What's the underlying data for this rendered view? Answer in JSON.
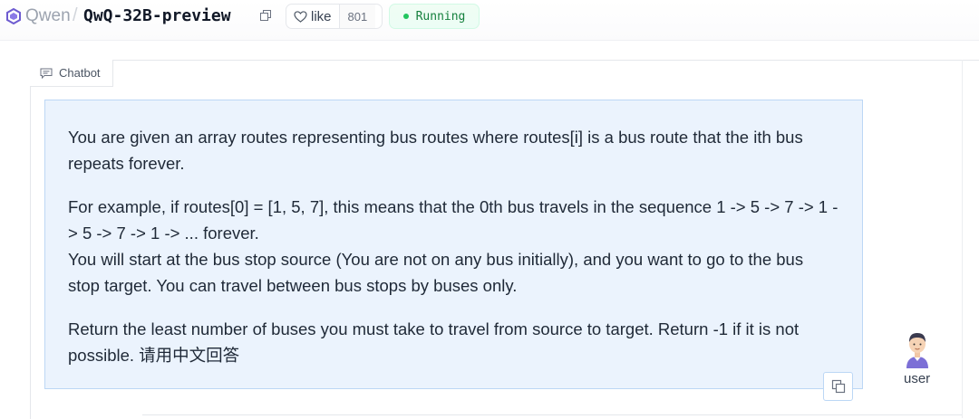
{
  "header": {
    "org_name": "Qwen",
    "separator": "/",
    "repo_name": "QwQ-32B-preview",
    "like_label": "like",
    "like_count": "801",
    "status": "Running",
    "status_color": "#22c55e"
  },
  "chatbot": {
    "tab_label": "Chatbot",
    "message": {
      "p1": "You are given an array routes representing bus routes where routes[i] is a bus route that the ith bus repeats forever.",
      "p2_line1": "For example, if routes[0] = [1, 5, 7], this means that the 0th bus travels in the sequence 1 -> 5 -> 7 -> 1 -> 5 -> 7 -> 1 -> ... forever.",
      "p2_line2": "You will start at the bus stop source (You are not on any bus initially), and you want to go to the bus stop target. You can travel between bus stops by buses only.",
      "p3": "Return the least number of buses you must take to travel from source to target. Return -1 if it is not possible. 请用中文回答"
    },
    "user_label": "user",
    "bubble_color": "#ebf3fd"
  },
  "icons": {
    "org_logo": "qwen-logo-icon",
    "copy_repo": "copy-icon",
    "like": "heart-icon",
    "tab": "chat-icon",
    "copy_message": "copy-icon",
    "avatar": "user-avatar-icon"
  }
}
